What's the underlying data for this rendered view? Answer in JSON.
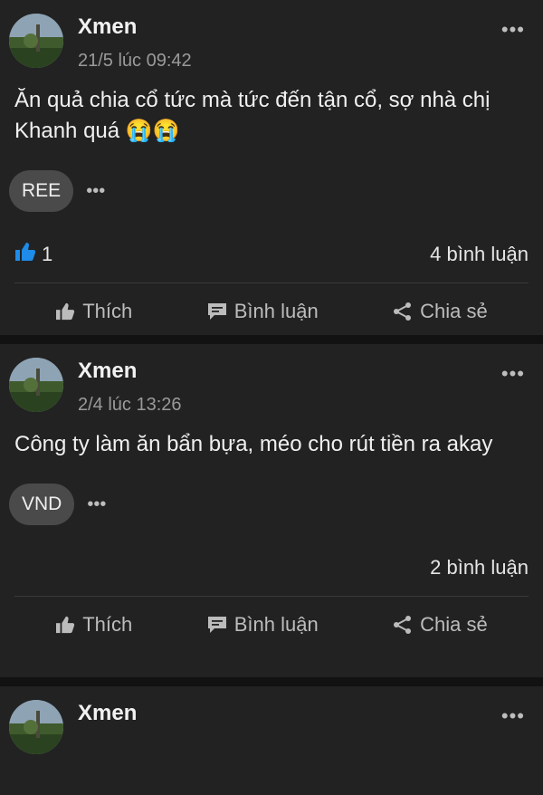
{
  "posts": [
    {
      "author": "Xmen",
      "timestamp": "21/5 lúc 09:42",
      "content": "Ăn quả chia cổ tức mà tức đến tận cổ, sợ nhà chị Khanh quá 😭😭",
      "tag": "REE",
      "likes": "1",
      "comments": "4 bình luận"
    },
    {
      "author": "Xmen",
      "timestamp": "2/4 lúc 13:26",
      "content": "Công ty làm ăn bẩn bựa, méo cho rút tiền ra akay",
      "tag": "VND",
      "comments": "2 bình luận"
    },
    {
      "author": "Xmen"
    }
  ],
  "actions": {
    "like": "Thích",
    "comment": "Bình luận",
    "share": "Chia sẻ"
  },
  "more_glyph": "•••",
  "colors": {
    "background": "#121212",
    "card": "#222222",
    "like_accent": "#1e8ce8"
  }
}
